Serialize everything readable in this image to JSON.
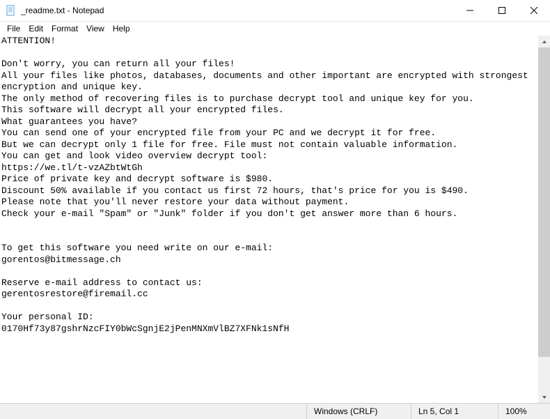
{
  "window": {
    "title": "_readme.txt - Notepad"
  },
  "menu": {
    "file": "File",
    "edit": "Edit",
    "format": "Format",
    "view": "View",
    "help": "Help"
  },
  "document": {
    "text": "ATTENTION!\n\nDon't worry, you can return all your files!\nAll your files like photos, databases, documents and other important are encrypted with strongest encryption and unique key.\nThe only method of recovering files is to purchase decrypt tool and unique key for you.\nThis software will decrypt all your encrypted files.\nWhat guarantees you have?\nYou can send one of your encrypted file from your PC and we decrypt it for free.\nBut we can decrypt only 1 file for free. File must not contain valuable information.\nYou can get and look video overview decrypt tool:\nhttps://we.tl/t-vzAZbtWtGh\nPrice of private key and decrypt software is $980.\nDiscount 50% available if you contact us first 72 hours, that's price for you is $490.\nPlease note that you'll never restore your data without payment.\nCheck your e-mail \"Spam\" or \"Junk\" folder if you don't get answer more than 6 hours.\n\n\nTo get this software you need write on our e-mail:\ngorentos@bitmessage.ch\n\nReserve e-mail address to contact us:\ngerentosrestore@firemail.cc\n\nYour personal ID:\n0170Hf73y87gshrNzcFIY0bWcSgnjE2jPenMNXmVlBZ7XFNk1sNfH"
  },
  "status": {
    "encoding": "Windows (CRLF)",
    "position": "Ln 5, Col 1",
    "zoom": "100%"
  }
}
